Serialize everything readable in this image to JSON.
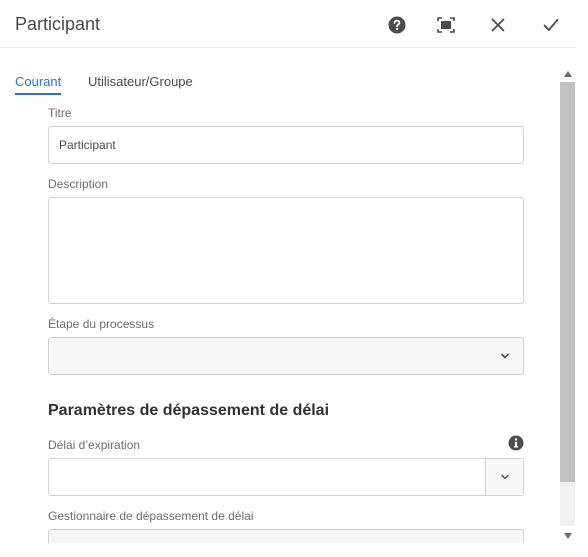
{
  "dialog": {
    "title": "Participant"
  },
  "header": {
    "help_icon": "help-icon",
    "fullscreen_icon": "fullscreen-icon",
    "close_icon": "close-icon",
    "confirm_icon": "check-icon"
  },
  "tabs": [
    {
      "label": "Courant",
      "active": true
    },
    {
      "label": "Utilisateur/Groupe",
      "active": false
    }
  ],
  "form": {
    "title_label": "Titre",
    "title_value": "Participant",
    "description_label": "Description",
    "description_value": "",
    "step_label": "Étape du processus",
    "step_value": "",
    "timeout_section_heading": "Paramètres de dépassement de délai",
    "timeout_label": "Délai d’expiration",
    "timeout_value": "",
    "timeout_handler_label": "Gestionnaire de dépassement de délai",
    "timeout_handler_value": ""
  },
  "colors": {
    "accent": "#2d73c9",
    "text": "#4b4b4b",
    "border": "#d3d3d3"
  }
}
